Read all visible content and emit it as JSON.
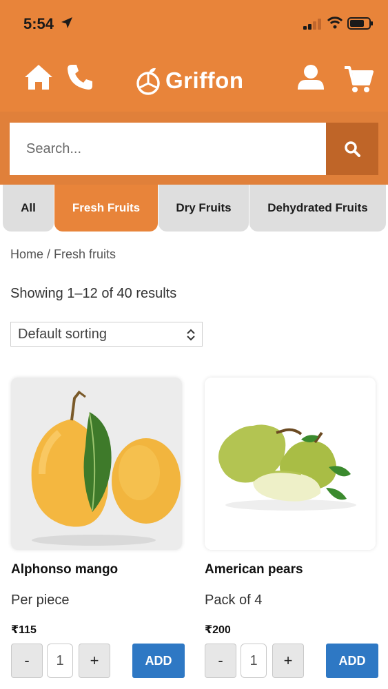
{
  "status": {
    "time": "5:54"
  },
  "brand": {
    "name": "Griffon"
  },
  "search": {
    "placeholder": "Search..."
  },
  "categories": [
    {
      "label": "All",
      "active": false
    },
    {
      "label": "Fresh Fruits",
      "active": true
    },
    {
      "label": "Dry Fruits",
      "active": false
    },
    {
      "label": "Dehydrated Fruits",
      "active": false
    }
  ],
  "breadcrumb": "Home / Fresh fruits",
  "results_text": "Showing 1–12 of 40 results",
  "sort": {
    "selected": "Default sorting"
  },
  "products": [
    {
      "name": "Alphonso mango",
      "unit": "Per piece",
      "price": "₹115",
      "qty": "1",
      "add_label": "ADD",
      "minus_label": "-",
      "plus_label": "+"
    },
    {
      "name": "American pears",
      "unit": "Pack of 4",
      "price": "₹200",
      "qty": "1",
      "add_label": "ADD",
      "minus_label": "-",
      "plus_label": "+"
    }
  ],
  "colors": {
    "brand_orange": "#e8843a",
    "search_button": "#bf6528",
    "add_button": "#2e78c4",
    "tab_inactive": "#dedede"
  }
}
